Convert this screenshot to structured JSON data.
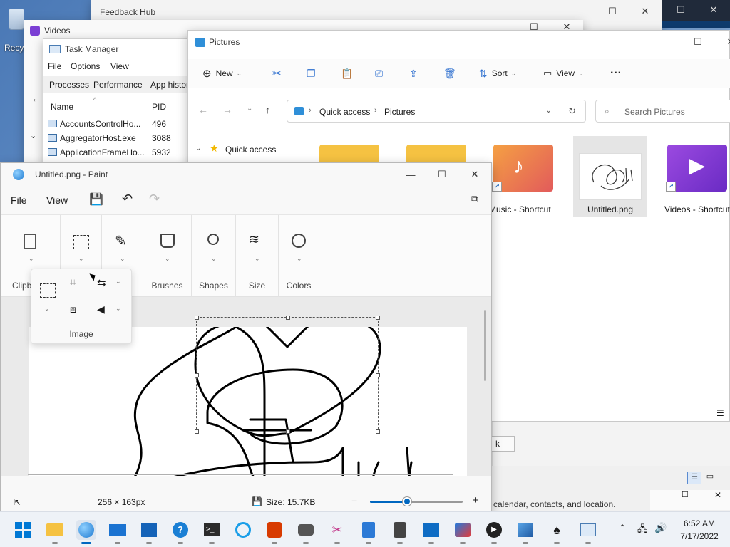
{
  "desktop": {
    "recycle_label": "Recy"
  },
  "feedback_hub": {
    "title": "Feedback Hub"
  },
  "videos_window": {
    "title": "Videos"
  },
  "task_manager": {
    "title": "Task Manager",
    "menu": [
      "File",
      "Options",
      "View"
    ],
    "tabs": [
      "Processes",
      "Performance",
      "App histor"
    ],
    "columns": {
      "name": "Name",
      "pid": "PID"
    },
    "rows": [
      {
        "name": "AccountsControlHo...",
        "pid": "496"
      },
      {
        "name": "AggregatorHost.exe",
        "pid": "3088"
      },
      {
        "name": "ApplicationFrameHo...",
        "pid": "5932"
      }
    ]
  },
  "explorer": {
    "title": "Pictures",
    "toolbar": {
      "new_label": "New",
      "sort_label": "Sort",
      "view_label": "View",
      "more": "···"
    },
    "breadcrumb": [
      "Quick access",
      "Pictures"
    ],
    "search_placeholder": "Search Pictures",
    "nav": {
      "quick_access": "Quick access"
    },
    "files": [
      {
        "name": "",
        "kind": "folder"
      },
      {
        "name": "",
        "kind": "folder"
      },
      {
        "name": "Music - Shortcut",
        "kind": "music-shortcut"
      },
      {
        "name": "Untitled.png",
        "kind": "image",
        "selected": true
      },
      {
        "name": "Videos - Shortcut",
        "kind": "videos-shortcut"
      }
    ]
  },
  "settings_fragment": {
    "text": "calendar, contacts, and location.",
    "button_fragment": "k"
  },
  "paint": {
    "title": "Untitled.png - Paint",
    "menu": {
      "file": "File",
      "view": "View"
    },
    "ribbon_groups": {
      "clipboard": "Clipb",
      "image": "Image",
      "brushes": "Brushes",
      "shapes": "Shapes",
      "size": "Size",
      "colors": "Colors"
    },
    "status": {
      "dimensions": "256 × 163px",
      "size": "Size: 15.7KB",
      "zoom_fraction": 0.4
    }
  },
  "taskbar": {
    "time": "6:52 AM",
    "date": "7/17/2022"
  },
  "colors": {
    "accent": "#0067c0",
    "folder_yellow": "#f5c242",
    "music_orange": "#f07b3f",
    "video_purple": "#8a3ad1"
  }
}
